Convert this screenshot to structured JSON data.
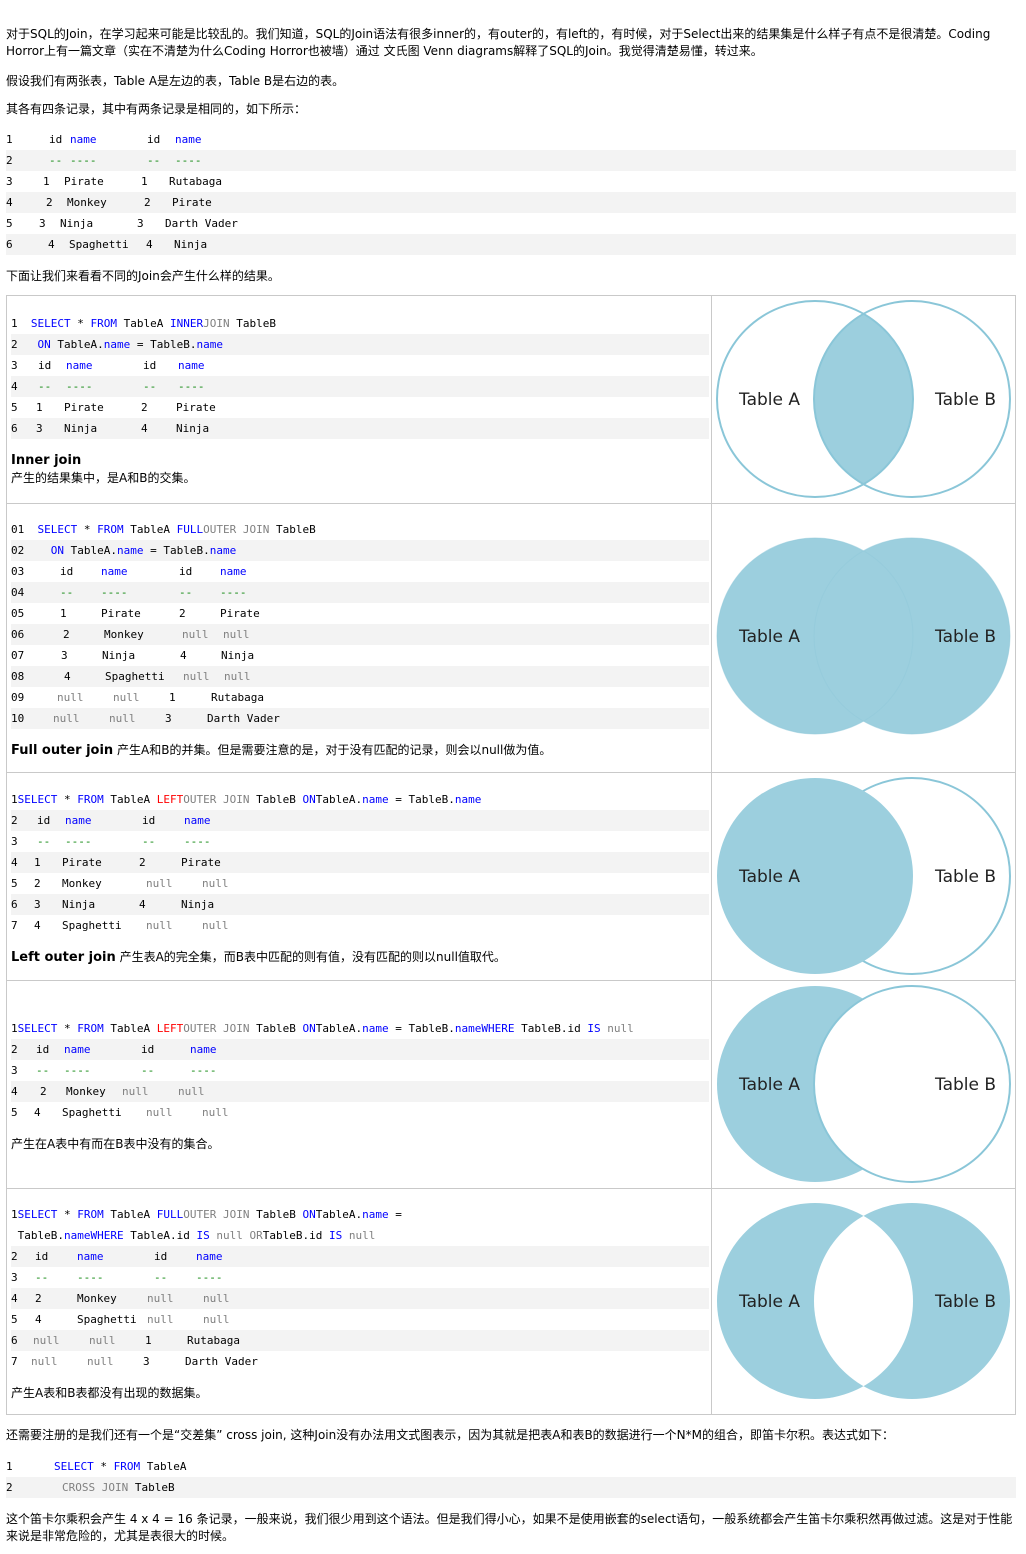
{
  "intro": {
    "p1": "对于SQL的Join，在学习起来可能是比较乱的。我们知道，SQL的Join语法有很多inner的，有outer的，有left的，有时候，对于Select出来的结果集是什么样子有点不是很清楚。Coding Horror上有一篇文章（实在不清楚为什么Coding Horror也被墙）通过 文氏图 Venn diagrams解释了SQL的Join。我觉得清楚易懂，转过来。",
    "p2": "假设我们有两张表，Table A是左边的表，Table B是右边的表。",
    "p3": "其各有四条记录，其中有两条记录是相同的，如下所示："
  },
  "tables_code": {
    "lines": [
      {
        "n": "1",
        "a": "id",
        "b": "name",
        "c": "id",
        "d": "name"
      },
      {
        "n": "2",
        "a": "--",
        "b": "----",
        "c": "--",
        "d": "----"
      },
      {
        "n": "3",
        "a": "1",
        "b": "Pirate",
        "c": "1",
        "d": "Rutabaga"
      },
      {
        "n": "4",
        "a": "2",
        "b": "Monkey",
        "c": "2",
        "d": "Pirate"
      },
      {
        "n": "5",
        "a": "3",
        "b": "Ninja",
        "c": "3",
        "d": "Darth Vader"
      },
      {
        "n": "6",
        "a": "4",
        "b": "Spaghetti",
        "c": "4",
        "d": "Ninja"
      }
    ]
  },
  "transition": "下面让我们来看看不同的Join会产生什么样的结果。",
  "venn": {
    "label_a": "Table A",
    "label_b": "Table B",
    "fill": "#9ccfde",
    "stroke": "#8ac6d8"
  },
  "inner": {
    "sql": {
      "n": "1",
      "select": "SELECT",
      "star": "*",
      "from": "FROM",
      "ta": "TableA",
      "inner": "INNER",
      "join": "JOIN",
      "tb": "TableB"
    },
    "on": {
      "n": "2",
      "on": "ON",
      "a": "TableA.",
      "name": "name",
      "eq": "=",
      "b": "TableB.",
      "name2": "name"
    },
    "rows": [
      {
        "n": "3",
        "a": "id",
        "b": "name",
        "c": "id",
        "d": "name"
      },
      {
        "n": "4",
        "a": "--",
        "b": "----",
        "c": "--",
        "d": "----"
      },
      {
        "n": "5",
        "a": "1",
        "b": "Pirate",
        "c": "2",
        "d": "Pirate"
      },
      {
        "n": "6",
        "a": "3",
        "b": "Ninja",
        "c": "4",
        "d": "Ninja"
      }
    ],
    "title": "Inner join",
    "desc": "产生的结果集中，是A和B的交集。"
  },
  "full": {
    "sql": {
      "n": "01",
      "select": "SELECT",
      "star": "*",
      "from": "FROM",
      "ta": "TableA",
      "full": "FULL",
      "outer": "OUTER",
      "join": "JOIN",
      "tb": "TableB"
    },
    "on": {
      "n": "02",
      "on": "ON",
      "a": "TableA.",
      "name": "name",
      "eq": "=",
      "b": "TableB.",
      "name2": "name"
    },
    "rows": [
      {
        "n": "03",
        "a": "id",
        "b": "name",
        "c": "id",
        "d": "name"
      },
      {
        "n": "04",
        "a": "--",
        "b": "----",
        "c": "--",
        "d": "----"
      },
      {
        "n": "05",
        "a": "1",
        "b": "Pirate",
        "c": "2",
        "d": "Pirate"
      },
      {
        "n": "06",
        "a": "2",
        "b": "Monkey",
        "c": "null",
        "d": "null"
      },
      {
        "n": "07",
        "a": "3",
        "b": "Ninja",
        "c": "4",
        "d": "Ninja"
      },
      {
        "n": "08",
        "a": "4",
        "b": "Spaghetti",
        "c": "null",
        "d": "null"
      },
      {
        "n": "09",
        "a": "null",
        "b": "null",
        "c": "1",
        "d": "Rutabaga"
      },
      {
        "n": "10",
        "a": "null",
        "b": "null",
        "c": "3",
        "d": "Darth Vader"
      }
    ],
    "title": "Full outer join",
    "desc": "产生A和B的并集。但是需要注意的是，对于没有匹配的记录，则会以null做为值。"
  },
  "left": {
    "sql": {
      "n": "1",
      "select": "SELECT",
      "star": "*",
      "from": "FROM",
      "ta": "TableA",
      "left": "LEFT",
      "outer": "OUTER",
      "join": "JOIN",
      "tb": "TableB",
      "on": "ON",
      "a": "TableA.",
      "name": "name",
      "eq": "=",
      "b": "TableB.",
      "name2": "name"
    },
    "rows": [
      {
        "n": "2",
        "a": "id",
        "b": "name",
        "c": "id",
        "d": "name"
      },
      {
        "n": "3",
        "a": "--",
        "b": "----",
        "c": "--",
        "d": "----"
      },
      {
        "n": "4",
        "a": "1",
        "b": "Pirate",
        "c": "2",
        "d": "Pirate"
      },
      {
        "n": "5",
        "a": "2",
        "b": "Monkey",
        "c": "null",
        "d": "null"
      },
      {
        "n": "6",
        "a": "3",
        "b": "Ninja",
        "c": "4",
        "d": "Ninja"
      },
      {
        "n": "7",
        "a": "4",
        "b": "Spaghetti",
        "c": "null",
        "d": "null"
      }
    ],
    "title": "Left outer join",
    "desc": "产生表A的完全集，而B表中匹配的则有值，没有匹配的则以null值取代。"
  },
  "leftonly": {
    "sql": {
      "n": "1",
      "select": "SELECT",
      "star": "*",
      "from": "FROM",
      "ta": "TableA",
      "left": "LEFT",
      "outer": "OUTER",
      "join": "JOIN",
      "tb": "TableB",
      "on": "ON",
      "a": "TableA.",
      "name": "name",
      "eq": "=",
      "b": "TableB.",
      "name2": "name",
      "where": "WHERE",
      "c": "TableB.id",
      "is": "IS",
      "null": "null"
    },
    "rows": [
      {
        "n": "2",
        "a": "id",
        "b": "name",
        "c": "id",
        "d": "name"
      },
      {
        "n": "3",
        "a": "--",
        "b": "----",
        "c": "--",
        "d": "----"
      },
      {
        "n": "4",
        "a": "2",
        "b": "Monkey",
        "c": "null",
        "d": "null"
      },
      {
        "n": "5",
        "a": "4",
        "b": "Spaghetti",
        "c": "null",
        "d": "null"
      }
    ],
    "desc": "产生在A表中有而在B表中没有的集合。"
  },
  "outeronly": {
    "sql": {
      "n": "1",
      "select": "SELECT",
      "star": "*",
      "from": "FROM",
      "ta": "TableA",
      "full": "FULL",
      "outer": "OUTER",
      "join": "JOIN",
      "tb": "TableB",
      "on": "ON",
      "a": "TableA.",
      "name": "name",
      "eq": "="
    },
    "sql2": {
      "b": "TableB.",
      "name2": "name",
      "where": "WHERE",
      "c": "TableA.id",
      "is": "IS",
      "null": "null",
      "or": "OR",
      "d": "TableB.id",
      "is2": "IS",
      "null2": "null"
    },
    "rows": [
      {
        "n": "2",
        "a": "id",
        "b": "name",
        "c": "id",
        "d": "name"
      },
      {
        "n": "3",
        "a": "--",
        "b": "----",
        "c": "--",
        "d": "----"
      },
      {
        "n": "4",
        "a": "2",
        "b": "Monkey",
        "c": "null",
        "d": "null"
      },
      {
        "n": "5",
        "a": "4",
        "b": "Spaghetti",
        "c": "null",
        "d": "null"
      },
      {
        "n": "6",
        "a": "null",
        "b": "null",
        "c": "1",
        "d": "Rutabaga"
      },
      {
        "n": "7",
        "a": "null",
        "b": "null",
        "c": "3",
        "d": "Darth Vader"
      }
    ],
    "desc": "产生A表和B表都没有出现的数据集。"
  },
  "cross": {
    "p": "还需要注册的是我们还有一个是“交差集” cross join, 这种Join没有办法用文式图表示，因为其就是把表A和表B的数据进行一个N*M的组合，即笛卡尔积。表达式如下：",
    "l1": {
      "n": "1",
      "select": "SELECT",
      "star": "*",
      "from": "FROM",
      "ta": "TableA"
    },
    "l2": {
      "n": "2",
      "cross": "CROSS",
      "join": "JOIN",
      "tb": "TableB"
    },
    "p2": "这个笛卡尔乘积会产生 4 x 4 = 16 条记录，一般来说，我们很少用到这个语法。但是我们得小心，如果不是使用嵌套的select语句，一般系统都会产生笛卡尔乘积然再做过滤。这是对于性能来说是非常危险的，尤其是表很大的时候。"
  }
}
